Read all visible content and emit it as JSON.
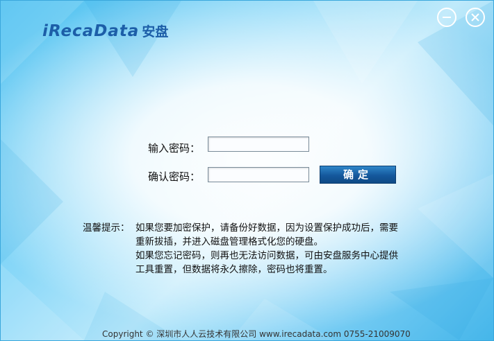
{
  "app": {
    "logo_wordmark": "iRecaData",
    "logo_cn": "安盘"
  },
  "window_controls": {
    "minimize_icon": "minimize-icon",
    "close_icon": "close-icon"
  },
  "form": {
    "password_label": "输入密码：",
    "password_value": "",
    "confirm_label": "确认密码：",
    "confirm_value": "",
    "confirm_button": "确定"
  },
  "tips": {
    "title": "温馨提示：",
    "lines": [
      "如果您要加密保护，请备份好数据，因为设置保护成功后，需要",
      "重新拔插，并进入磁盘管理格式化您的硬盘。",
      "如果您忘记密码，则再也无法访问数据，可由安盘服务中心提供",
      "工具重置，但数据将永久擦除，密码也将重置。"
    ]
  },
  "footer": {
    "text": "Copyright © 深圳市人人云技术有限公司    www.irecadata.com    0755-21009070"
  },
  "colors": {
    "brand_blue": "#1c5ea8",
    "button_blue": "#14589c",
    "sky_blue": "#4cc0f0"
  }
}
